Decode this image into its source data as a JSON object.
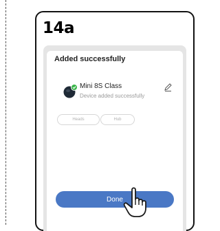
{
  "step_label": "14a",
  "dialog": {
    "title": "Added successfully",
    "device": {
      "name": "Mini 8S Class",
      "status": "Device added successfully",
      "icon": "speaker-icon",
      "edit_icon": "pencil-icon"
    },
    "chips": [
      "Heads",
      "Hub"
    ],
    "done_label": "Done"
  },
  "colors": {
    "accent": "#4a78c5",
    "check_badge": "#3ab54a",
    "screen_bg": "#e5e5e5"
  },
  "cursor_icon": "pointing-hand-icon"
}
